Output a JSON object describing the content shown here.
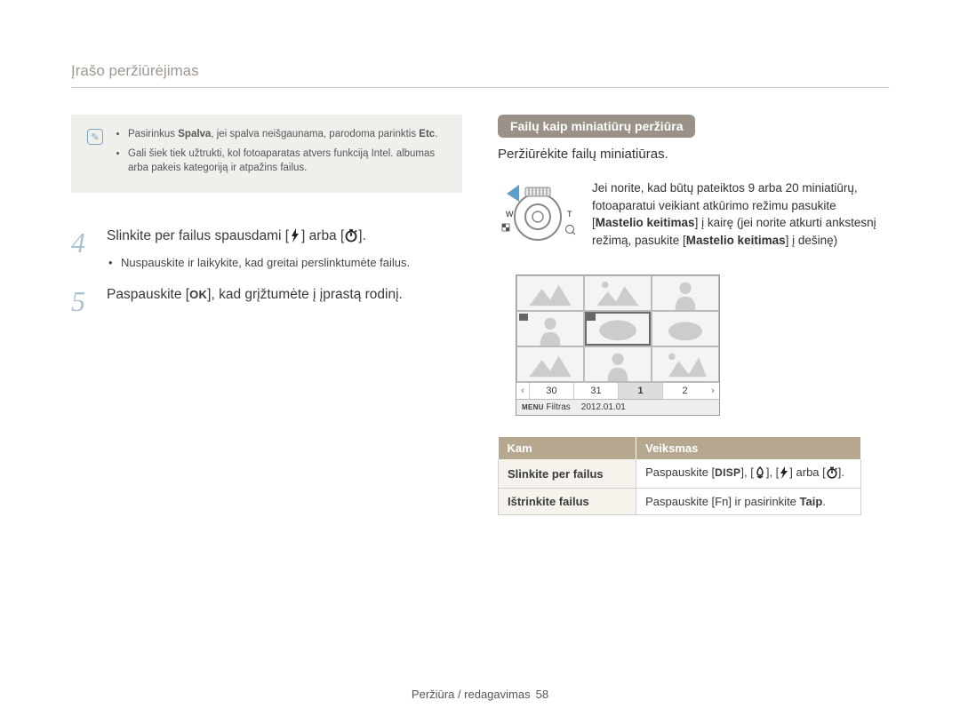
{
  "page_title": "Įrašo peržiūrėjimas",
  "note": {
    "items": [
      {
        "pre": "Pasirinkus ",
        "bold1": "Spalva",
        "mid": ", jei spalva neišgaunama, parodoma parinktis ",
        "bold2": "Etc",
        "post": "."
      },
      {
        "text": "Gali šiek tiek užtrukti, kol fotoaparatas atvers funkciją Intel. albumas arba pakeis kategoriją ir atpažins failus."
      }
    ]
  },
  "steps": {
    "s4": {
      "num": "4",
      "text_pre": "Slinkite per failus spausdami [",
      "text_mid": "] arba [",
      "text_post": "].",
      "sub": "Nuspauskite ir laikykite, kad greitai perslinktumėte failus."
    },
    "s5": {
      "num": "5",
      "text_pre": "Paspauskite [",
      "ok": "OK",
      "text_post": "], kad grįžtumėte į įprastą rodinį."
    }
  },
  "right": {
    "pill": "Failų kaip miniatiūrų peržiūra",
    "sub": "Peržiūrėkite failų miniatiūras.",
    "dial_desc_pre": "Jei norite, kad būtų pateiktos 9 arba 20 miniatiūrų, fotoaparatui veikiant atkūrimo režimu pasukite [",
    "dial_bold1": "Mastelio keitimas",
    "dial_desc_mid": "] į kairę (jei norite atkurti ankstesnį režimą, pasukite [",
    "dial_bold2": "Mastelio keitimas",
    "dial_desc_post": "] į dešinę)",
    "dial_labels": {
      "w": "W",
      "t": "T"
    },
    "preview": {
      "dates": [
        "30",
        "31",
        "1",
        "2"
      ],
      "menu_label": "MENU",
      "filter_label": "Filtras",
      "date_value": "2012.01.01"
    },
    "table": {
      "head1": "Kam",
      "head2": "Veiksmas",
      "row1": {
        "left": "Slinkite per failus",
        "pre": "Paspauskite [",
        "disp": "DISP",
        "mid1": "], [",
        "mid2": "], [",
        "mid3": "] arba [",
        "post": "]."
      },
      "row2": {
        "left": "Ištrinkite failus",
        "pre": "Paspauskite [",
        "fn": "Fn",
        "mid": "] ir pasirinkite ",
        "taip": "Taip",
        "post": "."
      }
    }
  },
  "footer": {
    "text": "Peržiūra / redagavimas",
    "page": "58"
  }
}
